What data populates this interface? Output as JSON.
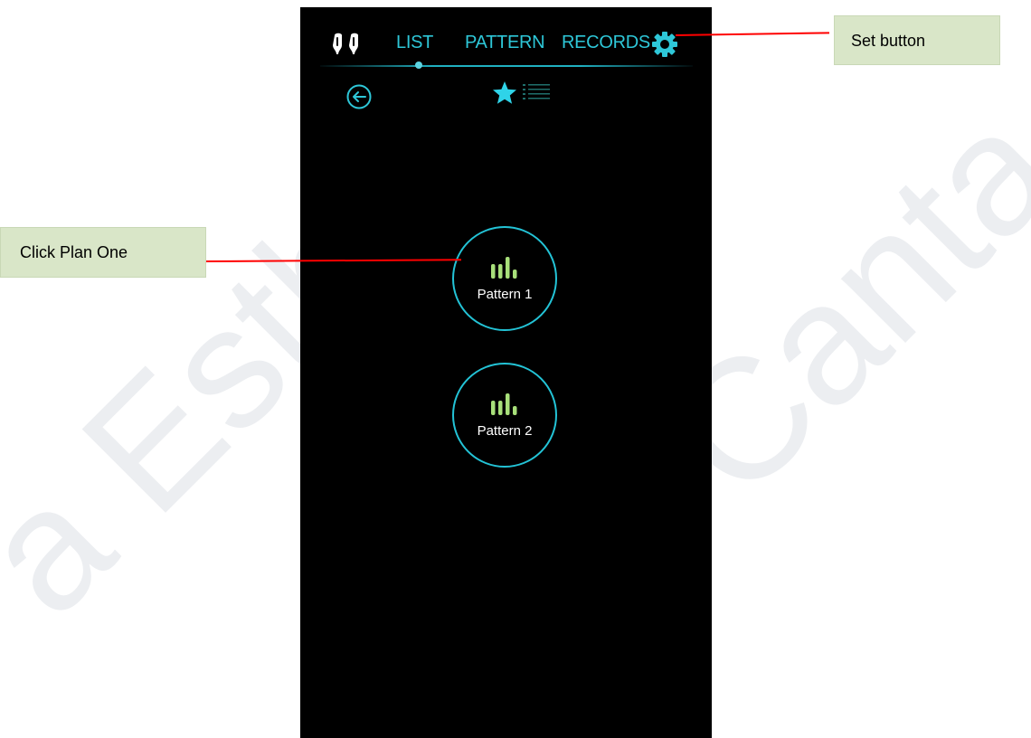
{
  "app": {
    "tabs": [
      {
        "label": "LIST",
        "active": true
      },
      {
        "label": "PATTERN",
        "active": false
      },
      {
        "label": "RECORDS",
        "active": false
      }
    ],
    "icons": {
      "brand": "earphones-icon",
      "settings": "gear-icon",
      "back": "back-arrow-icon",
      "favorites": "star-icon",
      "list": "list-icon",
      "pattern": "bars-icon"
    },
    "colors": {
      "background": "#000000",
      "accent": "#23c3d6",
      "bars": "#a8e07a",
      "text": "#ffffff"
    }
  },
  "patterns": [
    {
      "label": "Pattern 1"
    },
    {
      "label": "Pattern 2"
    }
  ],
  "callouts": {
    "set": "Set button",
    "plan": "Click Plan One"
  }
}
